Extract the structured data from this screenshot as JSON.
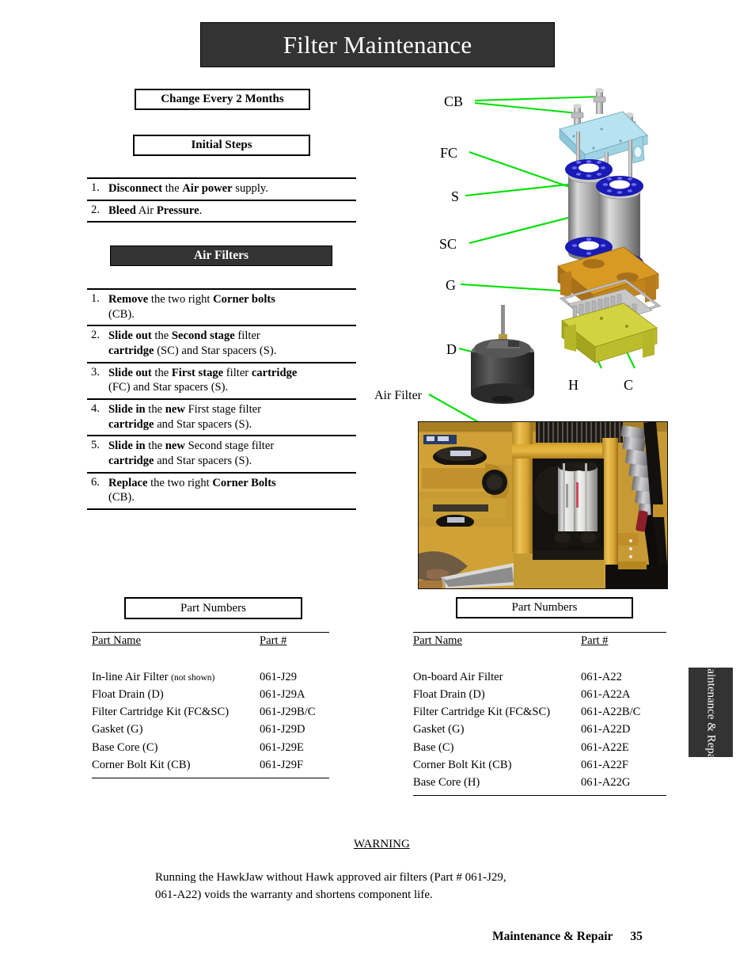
{
  "page": {
    "title": "Filter Maintenance",
    "footer_section": "Maintenance & Repair",
    "footer_page_number": "35",
    "side_tab_label": "Maintenance & Repair"
  },
  "left_column": {
    "interval_box": "Change Every 2 Months",
    "initial_steps_box": "Initial Steps",
    "initial_steps": [
      {
        "num": "1.",
        "html": "<b>Disconnect</b> the <b>Air power</b> supply."
      },
      {
        "num": "2.",
        "html": "<b>Bleed</b> Air <b>Pressure</b>."
      }
    ],
    "air_filters_bar": "Air Filters",
    "air_filter_steps": [
      {
        "num": "1.",
        "html": "<b>Remove</b> the two right <b>Corner bolts</b><br>(CB)."
      },
      {
        "num": "2.",
        "html": "<b>Slide out</b> the <b>Second stage</b> filter<br><b>cartridge</b> (SC) and Star spacers (S)."
      },
      {
        "num": "3.",
        "html": "<b>Slide out</b> the <b>First stage</b> filter <b>cartridge</b><br>(FC) and Star spacers (S)."
      },
      {
        "num": "4.",
        "html": "<b>Slide in</b> the <b>new</b> First stage filter<br><b>cartridge</b> and Star spacers (S)."
      },
      {
        "num": "5.",
        "html": "<b>Slide in</b> the <b>new</b> Second stage filter<br><b>cartridge</b> and Star spacers (S)."
      },
      {
        "num": "6.",
        "html": "<b>Replace</b> the two right <b>Corner Bolts</b><br>(CB)."
      }
    ]
  },
  "left_parts": {
    "box_title": "Part Numbers",
    "columns": [
      "Part Name",
      "Part #"
    ],
    "rows": [
      {
        "name": "In-line Air Filter",
        "note": "(not shown)",
        "part": "061-J29"
      },
      {
        "name": "Float Drain (D)",
        "note": "",
        "part": "061-J29A"
      },
      {
        "name": "Filter Cartridge Kit (FC&SC)",
        "note": "",
        "part": "061-J29B/C"
      },
      {
        "name": "Gasket (G)",
        "note": "",
        "part": "061-J29D"
      },
      {
        "name": "Base Core (C)",
        "note": "",
        "part": "061-J29E"
      },
      {
        "name": "Corner Bolt Kit (CB)",
        "note": "",
        "part": "061-J29F"
      }
    ]
  },
  "right_parts": {
    "box_title": "Part Numbers",
    "columns": [
      "Part Name",
      "Part #"
    ],
    "rows": [
      {
        "name": "On-board Air Filter",
        "note": "",
        "part": "061-A22"
      },
      {
        "name": "Float Drain (D)",
        "note": "",
        "part": "061-A22A"
      },
      {
        "name": "Filter Cartridge Kit (FC&SC)",
        "note": "",
        "part": "061-A22B/C"
      },
      {
        "name": "Gasket (G)",
        "note": "",
        "part": "061-A22D"
      },
      {
        "name": "Base  (C)",
        "note": "",
        "part": "061-A22E"
      },
      {
        "name": "Corner Bolt Kit (CB)",
        "note": "",
        "part": "061-A22F"
      },
      {
        "name": "Base Core (H)",
        "note": "",
        "part": "061-A22G"
      }
    ]
  },
  "diagram": {
    "labels": [
      {
        "key": "CB",
        "text": "CB"
      },
      {
        "key": "FC",
        "text": "FC"
      },
      {
        "key": "S",
        "text": "S"
      },
      {
        "key": "SC",
        "text": "SC"
      },
      {
        "key": "G",
        "text": "G"
      },
      {
        "key": "D",
        "text": "D"
      },
      {
        "key": "H",
        "text": "H"
      },
      {
        "key": "C",
        "text": "C"
      }
    ],
    "photo_label": "Air Filter",
    "leader_color": "#00e000"
  },
  "warning": {
    "heading": "WARNING",
    "line1": "Running the HawkJaw without Hawk approved air filters (Part # 061-J29,",
    "line2": " 061-A22) voids the warranty and shortens component life."
  },
  "colors": {
    "bar_dark": "#333333",
    "leader_green": "#00e000",
    "plate_blue": "#aadcec",
    "spacer_blue": "#1a1ab4",
    "block_orange": "#d4941e",
    "base_yellow": "#cfcf3a",
    "metal_gray": "#a8a8a8"
  }
}
